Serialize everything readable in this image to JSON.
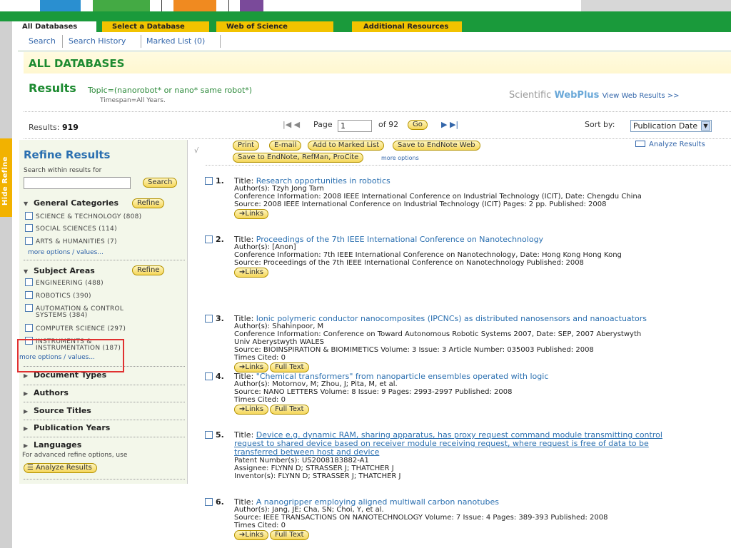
{
  "tabs": [
    "All Databases",
    "Select a Database",
    "Web of Science",
    "Additional Resources"
  ],
  "subnav": [
    "Search",
    "Search History",
    "Marked List (0)"
  ],
  "header": "ALL DATABASES",
  "results": {
    "label": "Results",
    "query": "Topic=(nanorobot* or nano* same robot*)",
    "timespan": "Timespan=All Years.",
    "webplus": "Scientific WebPlus",
    "webplus_a": "Scientific ",
    "webplus_b": "WebPlus",
    "view_web": "View Web Results >>"
  },
  "pager": {
    "results_label": "Results:",
    "results_count": "919",
    "page_label": "Page",
    "page_value": "1",
    "of_label": "of 92",
    "go": "Go",
    "sort_label": "Sort by:",
    "sort_value": "Publication Date"
  },
  "refine": {
    "title": "Refine Results",
    "search_within": "Search within results for",
    "search_btn": "Search",
    "refine_btn": "Refine",
    "general": "General Categories",
    "general_items": [
      "SCIENCE & TECHNOLOGY (808)",
      "SOCIAL SCIENCES (114)",
      "ARTS & HUMANITIES (7)"
    ],
    "more": "more options / values...",
    "subject": "Subject Areas",
    "subject_items": [
      "ENGINEERING (488)",
      "ROBOTICS (390)",
      "AUTOMATION & CONTROL",
      "SYSTEMS (384)",
      "COMPUTER SCIENCE (297)",
      "INSTRUMENTS &",
      "INSTRUMENTATION (187)"
    ],
    "doc_types": "Document Types",
    "authors": "Authors",
    "source_titles": "Source Titles",
    "pub_years": "Publication Years",
    "languages": "Languages",
    "adv": "For advanced refine options, use",
    "analyze": "Analyze Results",
    "hide": "Hide Refine"
  },
  "toolbar": {
    "print": "Print",
    "email": "E-mail",
    "add": "Add to Marked List",
    "save_endnote_web": "Save to EndNote Web",
    "save_endnote": "Save to EndNote, RefMan, ProCite",
    "more": "more options",
    "analyze": "Analyze Results"
  },
  "records": [
    {
      "n": "1.",
      "title": "Research opportunities in robotics",
      "lines": [
        "Author(s): Tzyh Jong Tarn",
        "Conference Information: 2008 IEEE International Conference on Industrial Technology (ICIT), Date: Chengdu China",
        "Source: 2008 IEEE International Conference on Industrial Technology (ICIT)   Pages: 2 pp.   Published: 2008"
      ],
      "buttons": [
        "Links"
      ]
    },
    {
      "n": "2.",
      "title": "Proceedings of the 7th IEEE International Conference on Nanotechnology",
      "lines": [
        "Author(s): [Anon]",
        "Conference Information: 7th IEEE International Conference on Nanotechnology, Date: Hong Kong Hong Kong",
        "Source: Proceedings of the 7th IEEE International Conference on Nanotechnology   Published: 2008"
      ],
      "buttons": [
        "Links"
      ]
    },
    {
      "n": "3.",
      "title": "Ionic polymeric conductor nanocomposites (IPCNCs) as distributed nanosensors and nanoactuators",
      "lines": [
        "Author(s): Shahinpoor, M",
        "Conference Information: Conference on Toward Autonomous Robotic Systems 2007, Date: SEP, 2007 Aberystwyth",
        "Univ Aberystwyth WALES",
        "Source: BIOINSPIRATION & BIOMIMETICS   Volume: 3   Issue: 3   Article Number: 035003   Published: 2008",
        "Times Cited: 0"
      ],
      "buttons": [
        "Links",
        "Full Text"
      ]
    },
    {
      "n": "4.",
      "title": "\"Chemical transformers\" from nanoparticle ensembles operated with logic",
      "lines": [
        "Author(s): Motornov, M; Zhou, J; Pita, M, et al.",
        "Source: NANO LETTERS   Volume: 8   Issue: 9   Pages: 2993-2997   Published: 2008",
        "Times Cited: 0"
      ],
      "buttons": [
        "Links",
        "Full Text"
      ]
    },
    {
      "n": "5.",
      "title_lines": [
        "Device e.g. dynamic RAM, sharing apparatus, has proxy request command module transmitting control",
        "request to shared device based on receiver module receiving request, where request is free of data to be",
        "transferred between host and device"
      ],
      "lines": [
        "Patent Number(s): US2008183882-A1",
        "Assignee: FLYNN D; STRASSER J; THATCHER J",
        "Inventor(s): FLYNN D; STRASSER J; THATCHER J"
      ],
      "buttons": []
    },
    {
      "n": "6.",
      "title": "A nanogripper employing aligned multiwall carbon nanotubes",
      "lines": [
        "Author(s): Jang, JE; Cha, SN; Choi, Y, et al.",
        "Source: IEEE TRANSACTIONS ON NANOTECHNOLOGY   Volume: 7   Issue: 4   Pages: 389-393   Published: 2008",
        "Times Cited: 0"
      ],
      "buttons": [
        "Links",
        "Full Text"
      ]
    }
  ],
  "title_label": "Title: ",
  "links_label": "Links",
  "colors": {
    "green": "#1a9a3b",
    "yellow": "#f2c300",
    "link": "#2a6fb0"
  }
}
